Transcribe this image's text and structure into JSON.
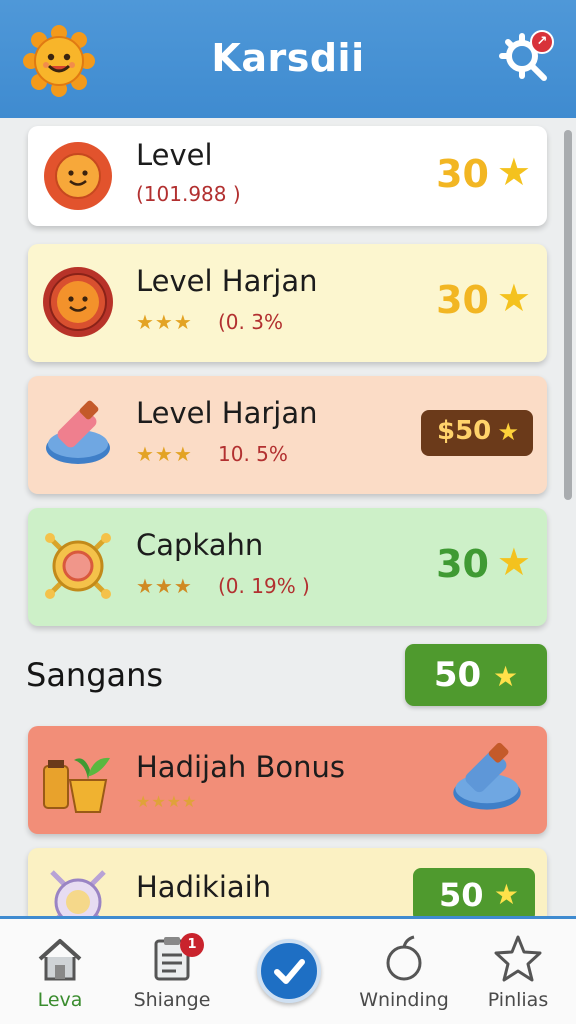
{
  "header": {
    "title": "Karsdii",
    "logo_icon": "sun-mascot-icon",
    "settings_icon": "gear-search-icon"
  },
  "cards": [
    {
      "icon": "sun-icon",
      "title": "Level",
      "subtitle": "(101.988 )",
      "value": "30",
      "bg": "#ffffff"
    },
    {
      "icon": "sun-medal-icon",
      "title": "Level Harjan",
      "stars": "★★★",
      "pct": "(0. 3%",
      "value": "30",
      "bg": "#fcf6cf"
    },
    {
      "icon": "eraser-icon",
      "title": "Level Harjan",
      "stars": "★★★",
      "pct": "10. 5%",
      "value": "$50",
      "bg": "#fbdcc6"
    },
    {
      "icon": "ring-gem-icon",
      "title": "Capkahn",
      "stars": "★★★",
      "pct": "(0. 19% )",
      "value": "30",
      "bg": "#cdf0c8"
    },
    {
      "icon": "plant-pot-icon",
      "title": "Hadijah Bonus",
      "stars": "★★★★",
      "bg": "#f28e78"
    },
    {
      "icon": "ring-icon",
      "title": "Hadikiaih",
      "value": "50",
      "bg": "#fbf1c3"
    }
  ],
  "section": {
    "title": "Sangans",
    "value": "50"
  },
  "nav": [
    {
      "label": "Leva",
      "icon": "home-icon"
    },
    {
      "label": "Shiange",
      "icon": "clipboard-icon",
      "badge": "1"
    },
    {
      "label": "",
      "icon": "check-circle-icon"
    },
    {
      "label": "Wninding",
      "icon": "apple-icon"
    },
    {
      "label": "Pinlias",
      "icon": "star-outline-icon"
    }
  ]
}
